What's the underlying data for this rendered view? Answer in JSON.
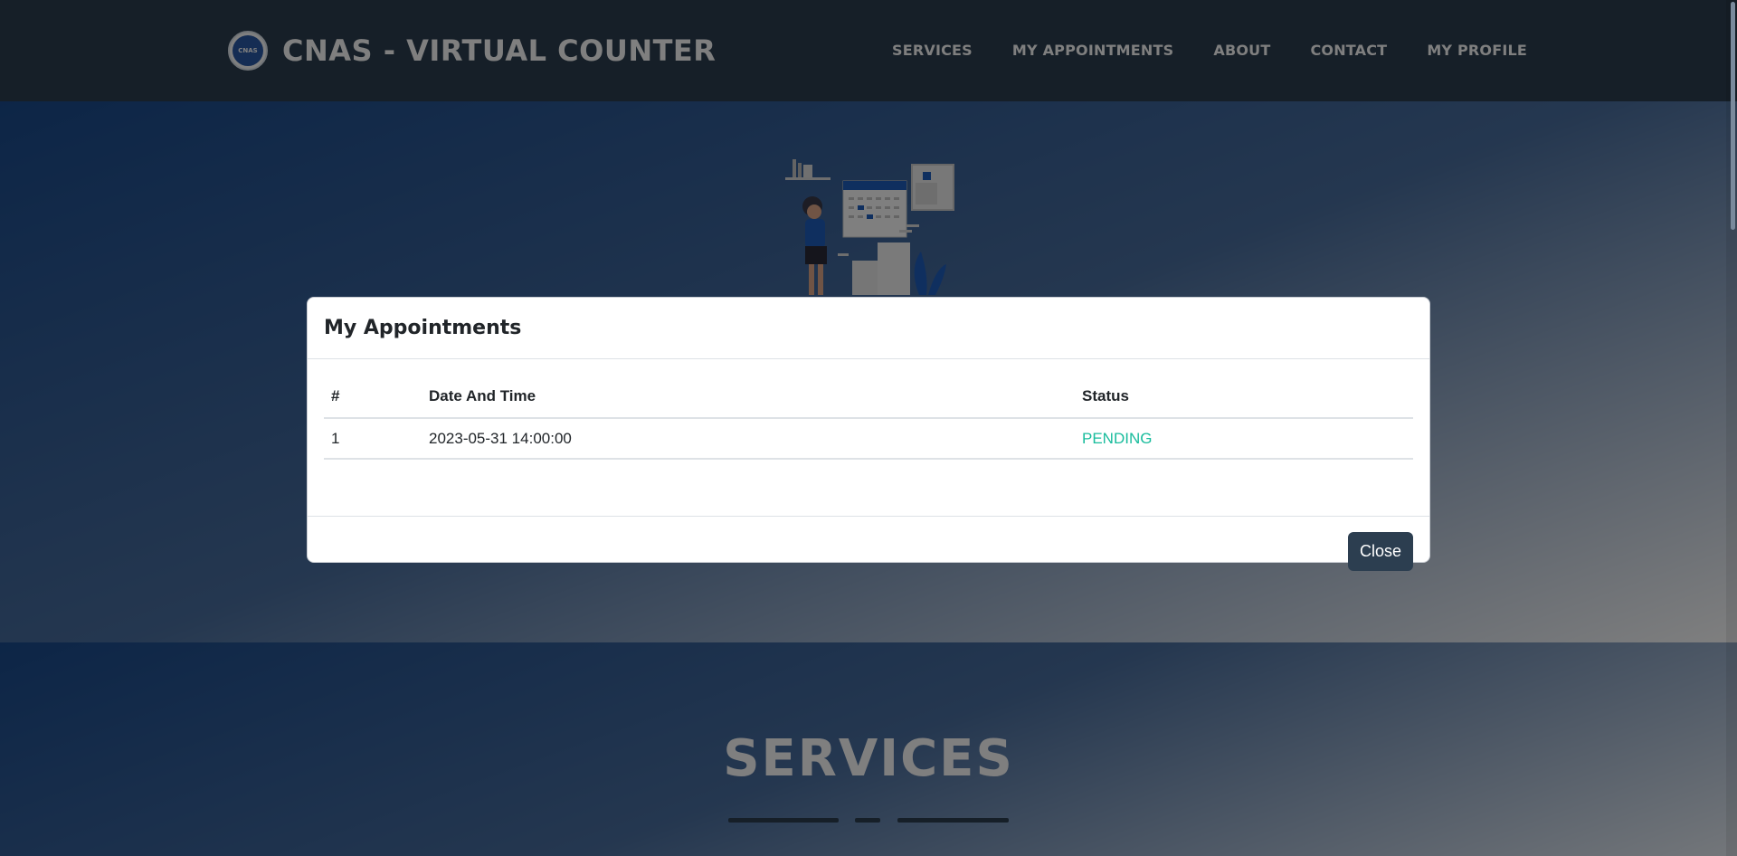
{
  "brand": {
    "title": "CNAS - VIRTUAL COUNTER",
    "logo_text": "CNAS"
  },
  "nav": {
    "items": [
      {
        "label": "SERVICES"
      },
      {
        "label": "MY APPOINTMENTS"
      },
      {
        "label": "ABOUT"
      },
      {
        "label": "CONTACT"
      },
      {
        "label": "MY PROFILE"
      }
    ]
  },
  "services": {
    "title": "SERVICES"
  },
  "modal": {
    "title": "My Appointments",
    "columns": {
      "num": "#",
      "date": "Date And Time",
      "status": "Status"
    },
    "rows": [
      {
        "num": "1",
        "date": "2023-05-31 14:00:00",
        "status": "PENDING"
      }
    ],
    "close_label": "Close"
  },
  "colors": {
    "navbar": "#2c3e50",
    "accent_pending": "#18bc9c",
    "button": "#2c3e50"
  }
}
